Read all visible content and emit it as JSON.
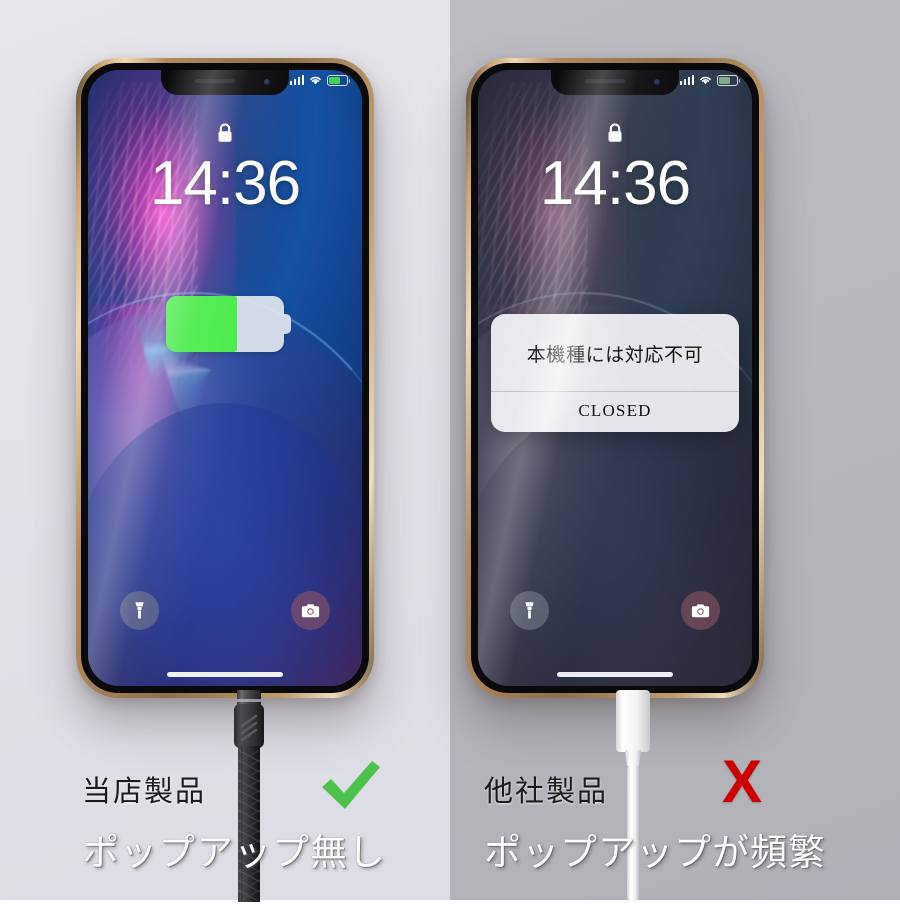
{
  "background": {
    "left_panel_color": "#e1e1e8",
    "right_panel_color": "#b7b7bd"
  },
  "phones": [
    {
      "id": "left-phone",
      "frame_color": "#b08a5c",
      "status_bar": {
        "signal_icon": "cellular-signal-icon",
        "wifi_icon": "wifi-icon",
        "battery_icon": "battery-icon",
        "battery_fill_percent": 58,
        "battery_color": "#46d257"
      },
      "lock_icon": "lock-closed-icon",
      "time": "14:36",
      "charging_indicator": {
        "visible": true,
        "level_percent": 60,
        "fill_color": "#4ceb4c"
      },
      "popup": null,
      "shortcuts": {
        "flashlight_icon": "flashlight-icon",
        "camera_icon": "camera-icon"
      },
      "home_indicator": true
    },
    {
      "id": "right-phone",
      "frame_color": "#b08a5c",
      "status_bar": {
        "signal_icon": "cellular-signal-icon",
        "wifi_icon": "wifi-icon",
        "battery_icon": "battery-icon",
        "battery_fill_percent": 58,
        "battery_color": "#7fae86"
      },
      "lock_icon": "lock-closed-icon",
      "time": "14:36",
      "charging_indicator": {
        "visible": false,
        "level_percent": 0,
        "fill_color": "#4ceb4c"
      },
      "popup": {
        "message": "本機種には対応不可",
        "button_label": "CLOSED"
      },
      "shortcuts": {
        "flashlight_icon": "flashlight-icon",
        "camera_icon": "camera-icon"
      },
      "home_indicator": true
    }
  ],
  "captions": {
    "left": {
      "product_label": "当店製品",
      "result_label": "ポップアップ無し",
      "mark": "check-mark",
      "mark_color": "#4cc24c",
      "cable_type": "black-braided-cable"
    },
    "right": {
      "product_label": "他社製品",
      "result_label": "ポップアップが頻繁",
      "mark": "cross-mark",
      "mark_label": "X",
      "mark_color": "#cc0000",
      "cable_type": "white-lightning-cable"
    }
  }
}
